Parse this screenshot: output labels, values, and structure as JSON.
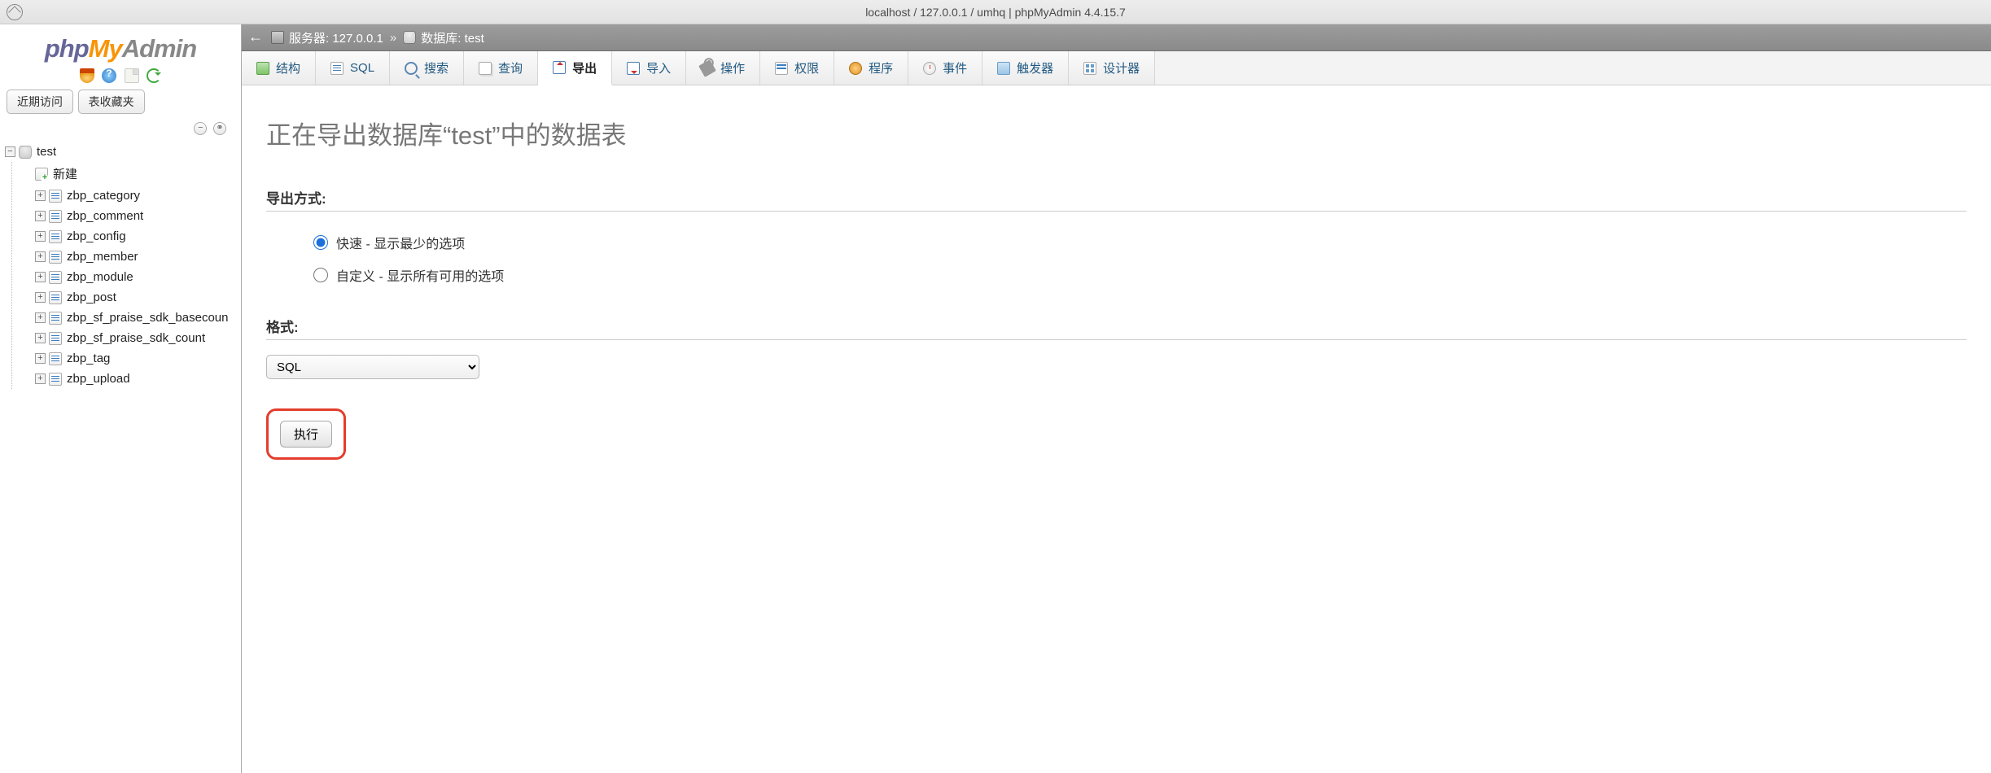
{
  "window": {
    "title": "localhost / 127.0.0.1 / umhq | phpMyAdmin 4.4.15.7"
  },
  "logo": {
    "part1": "php",
    "part2": "My",
    "part3": "Admin"
  },
  "sidebar_tabs": {
    "recent": "近期访问",
    "favorites": "表收藏夹"
  },
  "tree": {
    "db": "test",
    "new_label": "新建",
    "tables": [
      "zbp_category",
      "zbp_comment",
      "zbp_config",
      "zbp_member",
      "zbp_module",
      "zbp_post",
      "zbp_sf_praise_sdk_basecoun",
      "zbp_sf_praise_sdk_count",
      "zbp_tag",
      "zbp_upload"
    ]
  },
  "breadcrumb": {
    "server_label": "服务器: 127.0.0.1",
    "db_label": "数据库: test",
    "sep": "»"
  },
  "tabs": {
    "structure": "结构",
    "sql": "SQL",
    "search": "搜索",
    "query": "查询",
    "export": "导出",
    "import": "导入",
    "operations": "操作",
    "privileges": "权限",
    "routines": "程序",
    "events": "事件",
    "triggers": "触发器",
    "designer": "设计器"
  },
  "page": {
    "heading": "正在导出数据库“test”中的数据表",
    "export_method_label": "导出方式:",
    "method_quick": "快速 - 显示最少的选项",
    "method_custom": "自定义 - 显示所有可用的选项",
    "format_label": "格式:",
    "format_selected": "SQL",
    "go": "执行"
  }
}
